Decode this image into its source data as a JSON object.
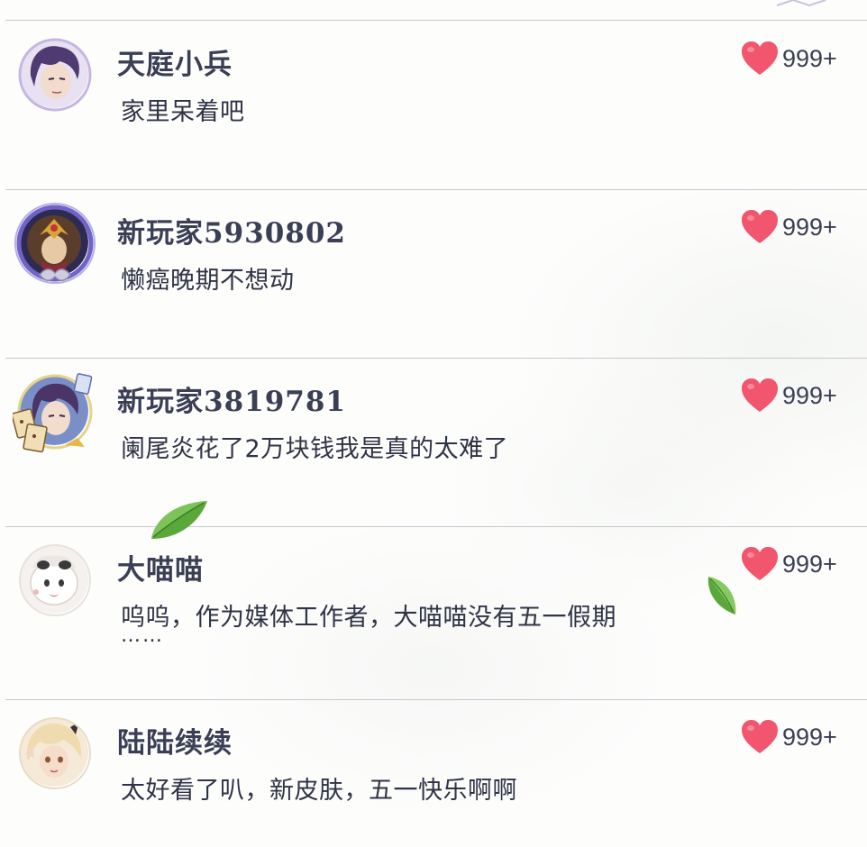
{
  "colors": {
    "heart": "#f2556e",
    "username": "#3a3f55",
    "text": "#2f3346",
    "divider": "#c9c8cf",
    "leaf": "#5aa83a"
  },
  "comments": [
    {
      "username": "天庭小兵",
      "text": "家里呆着吧",
      "text2": "",
      "likes": "999+",
      "avatar_icon": "purple-hair-hero-avatar-icon"
    },
    {
      "username": "新玩家5930802",
      "text": "懒癌晚期不想动",
      "text2": "",
      "likes": "999+",
      "avatar_icon": "crowned-hero-framed-avatar-icon"
    },
    {
      "username": "新玩家3819781",
      "text": "阑尾炎花了2万块钱我是真的太难了",
      "text2": "",
      "likes": "999+",
      "avatar_icon": "card-frame-hero-avatar-icon"
    },
    {
      "username": "大喵喵",
      "text": "呜呜，作为媒体工作者，大喵喵没有五一假期",
      "text2": "……",
      "likes": "999+",
      "avatar_icon": "white-cat-avatar-icon"
    },
    {
      "username": "陆陆续续",
      "text": "太好看了叭，新皮肤，五一快乐啊啊",
      "text2": "",
      "likes": "999+",
      "avatar_icon": "blonde-hero-avatar-icon"
    }
  ]
}
